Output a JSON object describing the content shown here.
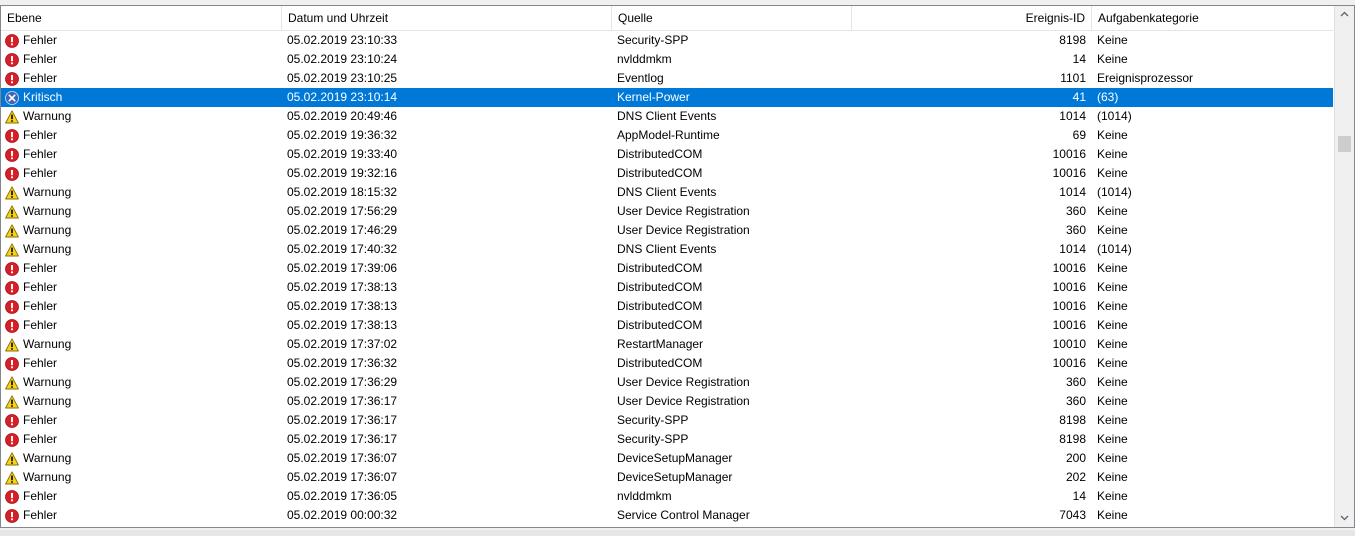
{
  "columns": {
    "level": "Ebene",
    "date": "Datum und Uhrzeit",
    "source": "Quelle",
    "event_id": "Ereignis-ID",
    "category": "Aufgabenkategorie"
  },
  "colors": {
    "error": "#d61f26",
    "warning": "#f7d416",
    "critical": "#3a68b8",
    "selection": "#0078d7"
  },
  "selected_row_index": 3,
  "events": [
    {
      "level": "Fehler",
      "icon": "error-icon",
      "date": "05.02.2019 23:10:33",
      "source": "Security-SPP",
      "id": "8198",
      "category": "Keine"
    },
    {
      "level": "Fehler",
      "icon": "error-icon",
      "date": "05.02.2019 23:10:24",
      "source": "nvlddmkm",
      "id": "14",
      "category": "Keine"
    },
    {
      "level": "Fehler",
      "icon": "error-icon",
      "date": "05.02.2019 23:10:25",
      "source": "Eventlog",
      "id": "1101",
      "category": "Ereignisprozessor"
    },
    {
      "level": "Kritisch",
      "icon": "critical-icon",
      "date": "05.02.2019 23:10:14",
      "source": "Kernel-Power",
      "id": "41",
      "category": "(63)"
    },
    {
      "level": "Warnung",
      "icon": "warning-icon",
      "date": "05.02.2019 20:49:46",
      "source": "DNS Client Events",
      "id": "1014",
      "category": "(1014)"
    },
    {
      "level": "Fehler",
      "icon": "error-icon",
      "date": "05.02.2019 19:36:32",
      "source": "AppModel-Runtime",
      "id": "69",
      "category": "Keine"
    },
    {
      "level": "Fehler",
      "icon": "error-icon",
      "date": "05.02.2019 19:33:40",
      "source": "DistributedCOM",
      "id": "10016",
      "category": "Keine"
    },
    {
      "level": "Fehler",
      "icon": "error-icon",
      "date": "05.02.2019 19:32:16",
      "source": "DistributedCOM",
      "id": "10016",
      "category": "Keine"
    },
    {
      "level": "Warnung",
      "icon": "warning-icon",
      "date": "05.02.2019 18:15:32",
      "source": "DNS Client Events",
      "id": "1014",
      "category": "(1014)"
    },
    {
      "level": "Warnung",
      "icon": "warning-icon",
      "date": "05.02.2019 17:56:29",
      "source": "User Device Registration",
      "id": "360",
      "category": "Keine"
    },
    {
      "level": "Warnung",
      "icon": "warning-icon",
      "date": "05.02.2019 17:46:29",
      "source": "User Device Registration",
      "id": "360",
      "category": "Keine"
    },
    {
      "level": "Warnung",
      "icon": "warning-icon",
      "date": "05.02.2019 17:40:32",
      "source": "DNS Client Events",
      "id": "1014",
      "category": "(1014)"
    },
    {
      "level": "Fehler",
      "icon": "error-icon",
      "date": "05.02.2019 17:39:06",
      "source": "DistributedCOM",
      "id": "10016",
      "category": "Keine"
    },
    {
      "level": "Fehler",
      "icon": "error-icon",
      "date": "05.02.2019 17:38:13",
      "source": "DistributedCOM",
      "id": "10016",
      "category": "Keine"
    },
    {
      "level": "Fehler",
      "icon": "error-icon",
      "date": "05.02.2019 17:38:13",
      "source": "DistributedCOM",
      "id": "10016",
      "category": "Keine"
    },
    {
      "level": "Fehler",
      "icon": "error-icon",
      "date": "05.02.2019 17:38:13",
      "source": "DistributedCOM",
      "id": "10016",
      "category": "Keine"
    },
    {
      "level": "Warnung",
      "icon": "warning-icon",
      "date": "05.02.2019 17:37:02",
      "source": "RestartManager",
      "id": "10010",
      "category": "Keine"
    },
    {
      "level": "Fehler",
      "icon": "error-icon",
      "date": "05.02.2019 17:36:32",
      "source": "DistributedCOM",
      "id": "10016",
      "category": "Keine"
    },
    {
      "level": "Warnung",
      "icon": "warning-icon",
      "date": "05.02.2019 17:36:29",
      "source": "User Device Registration",
      "id": "360",
      "category": "Keine"
    },
    {
      "level": "Warnung",
      "icon": "warning-icon",
      "date": "05.02.2019 17:36:17",
      "source": "User Device Registration",
      "id": "360",
      "category": "Keine"
    },
    {
      "level": "Fehler",
      "icon": "error-icon",
      "date": "05.02.2019 17:36:17",
      "source": "Security-SPP",
      "id": "8198",
      "category": "Keine"
    },
    {
      "level": "Fehler",
      "icon": "error-icon",
      "date": "05.02.2019 17:36:17",
      "source": "Security-SPP",
      "id": "8198",
      "category": "Keine"
    },
    {
      "level": "Warnung",
      "icon": "warning-icon",
      "date": "05.02.2019 17:36:07",
      "source": "DeviceSetupManager",
      "id": "200",
      "category": "Keine"
    },
    {
      "level": "Warnung",
      "icon": "warning-icon",
      "date": "05.02.2019 17:36:07",
      "source": "DeviceSetupManager",
      "id": "202",
      "category": "Keine"
    },
    {
      "level": "Fehler",
      "icon": "error-icon",
      "date": "05.02.2019 17:36:05",
      "source": "nvlddmkm",
      "id": "14",
      "category": "Keine"
    },
    {
      "level": "Fehler",
      "icon": "error-icon",
      "date": "05.02.2019 00:00:32",
      "source": "Service Control Manager",
      "id": "7043",
      "category": "Keine"
    }
  ]
}
